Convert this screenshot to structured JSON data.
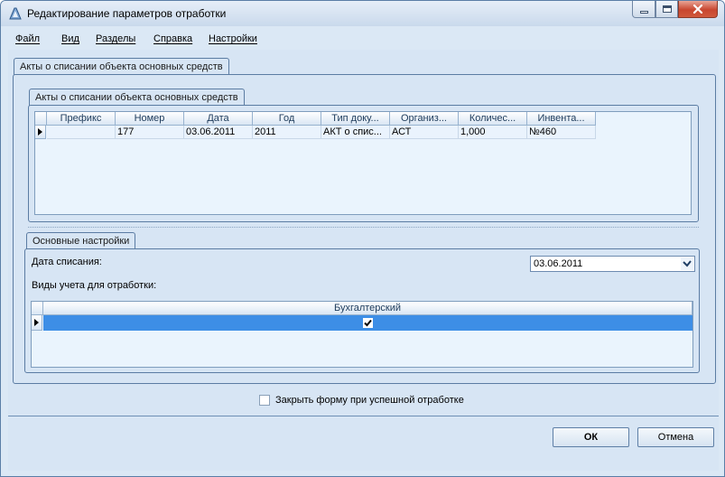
{
  "window": {
    "title": "Редактирование параметров отработки"
  },
  "menu": [
    "Файл",
    "Вид",
    "Разделы",
    "Справка",
    "Настройки"
  ],
  "outer_tab": "Акты о списании объекта основных средств",
  "inner_tab": "Акты о списании объекта основных средств",
  "acts_grid": {
    "columns": [
      "Префикс",
      "Номер",
      "Дата",
      "Год",
      "Тип доку...",
      "Организ...",
      "Количес...",
      "Инвента..."
    ],
    "rows": [
      [
        "",
        "177",
        "03.06.2011",
        "2011",
        "АКТ о спис...",
        "АСТ",
        "1,000",
        "№460"
      ]
    ]
  },
  "settings": {
    "tab": "Основные настройки",
    "date_label": "Дата списания:",
    "date_value": "03.06.2011",
    "accounting_label": "Виды учета для отработки:",
    "accounting_grid": {
      "column": "Бухгалтерский",
      "checked": true
    }
  },
  "close_form": {
    "label": "Закрыть форму при успешной отработке",
    "checked": false
  },
  "buttons": {
    "ok": "ОК",
    "cancel": "Отмена"
  },
  "colors": {
    "selected_row": "#3d8ee6",
    "window_bg": "#d7e5f4",
    "border": "#5b7ca3"
  }
}
